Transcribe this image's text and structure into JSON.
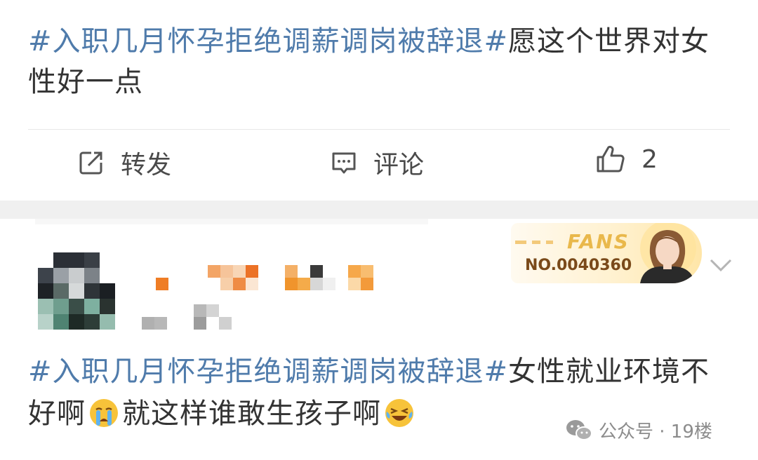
{
  "post1": {
    "hashtag": "#入职几月怀孕拒绝调薪调岗被辞退#",
    "text": "愿这个世界对女性好一点"
  },
  "actions": {
    "repost_label": "转发",
    "comment_label": "评论",
    "like_count": "2"
  },
  "comment": {
    "fans_badge": {
      "label": "FANS",
      "number": "NO.0040360"
    },
    "hashtag": "#入职几月怀孕拒绝调薪调岗被辞退#",
    "text_part1": "女性就业环境不好啊",
    "text_part2": "就这样谁敢生孩子啊",
    "emoji1": "crying-face",
    "emoji2": "laughing-tears-face"
  },
  "watermark": {
    "text": "公众号 · 19楼"
  },
  "colors": {
    "hashtag": "#4f7bab",
    "text": "#333333",
    "fans_gold": "#e9b84b"
  }
}
